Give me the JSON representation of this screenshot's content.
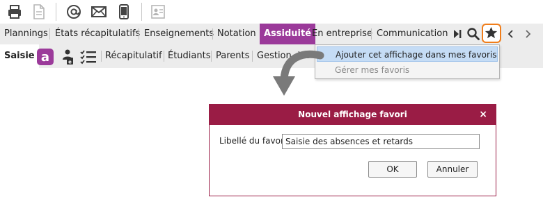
{
  "toolbar": {
    "icons": [
      "print-icon",
      "document-icon",
      "at-icon",
      "mail-icon",
      "mobile-icon",
      "contact-card-icon"
    ]
  },
  "tabs": [
    {
      "label": "Plannings"
    },
    {
      "label": "États récapitulatifs"
    },
    {
      "label": "Enseignements"
    },
    {
      "label": "Notation"
    },
    {
      "label": "Assiduité",
      "active": true
    },
    {
      "label": "En entreprise"
    },
    {
      "label": "Communication"
    }
  ],
  "subtabs": [
    {
      "label": "Saisie",
      "active": true
    },
    {
      "label": "Récapitulatif"
    },
    {
      "label": "Étudiants"
    },
    {
      "label": "Parents"
    },
    {
      "label": "Gestion des a"
    }
  ],
  "dropdown": {
    "items": [
      {
        "label": "Ajouter cet affichage dans mes favoris",
        "highlighted": true
      },
      {
        "label": "Gérer mes favoris",
        "disabled": true
      }
    ]
  },
  "dialog": {
    "title": "Nouvel affichage favori",
    "close": "×",
    "field_label": "Libellé du favori",
    "field_value": "Saisie des absences et retards",
    "ok": "OK",
    "cancel": "Annuler"
  },
  "colors": {
    "accent_purple": "#9b3a9a",
    "dialog_header": "#9a1c45",
    "highlight_ring": "#f07d1a"
  }
}
